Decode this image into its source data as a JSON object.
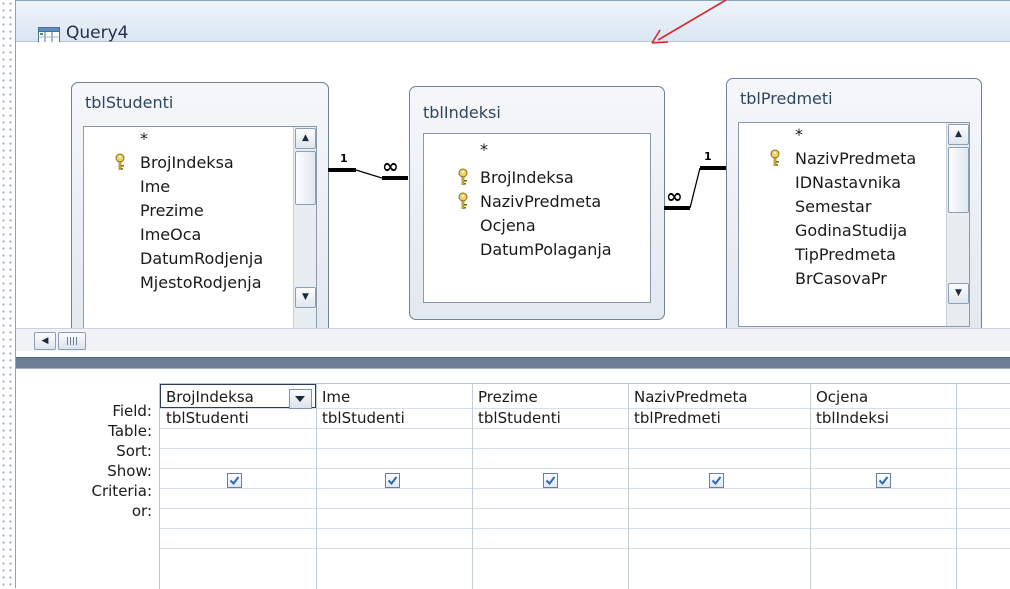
{
  "window": {
    "title": "Query4"
  },
  "tables": [
    {
      "name": "tblStudenti",
      "fields": [
        {
          "label": "*",
          "key": false
        },
        {
          "label": "BrojIndeksa",
          "key": true
        },
        {
          "label": "Ime",
          "key": false
        },
        {
          "label": "Prezime",
          "key": false
        },
        {
          "label": "ImeOca",
          "key": false
        },
        {
          "label": "DatumRodjenja",
          "key": false
        },
        {
          "label": "MjestoRodjenja",
          "key": false
        }
      ]
    },
    {
      "name": "tblIndeksi",
      "fields": [
        {
          "label": "*",
          "key": false
        },
        {
          "label": "BrojIndeksa",
          "key": true
        },
        {
          "label": "NazivPredmeta",
          "key": true
        },
        {
          "label": "Ocjena",
          "key": false
        },
        {
          "label": "DatumPolaganja",
          "key": false
        }
      ]
    },
    {
      "name": "tblPredmeti",
      "fields": [
        {
          "label": "*",
          "key": false
        },
        {
          "label": "NazivPredmeta",
          "key": true
        },
        {
          "label": "IDNastavnika",
          "key": false
        },
        {
          "label": "Semestar",
          "key": false
        },
        {
          "label": "GodinaStudija",
          "key": false
        },
        {
          "label": "TipPredmeta",
          "key": false
        },
        {
          "label": "BrCasovaPr",
          "key": false
        }
      ]
    }
  ],
  "joins": [
    {
      "one_label": "1",
      "many_label": "∞"
    },
    {
      "one_label": "1",
      "many_label": "∞"
    }
  ],
  "grid": {
    "row_labels": [
      "Field:",
      "Table:",
      "Sort:",
      "Show:",
      "Criteria:",
      "or:"
    ],
    "columns": [
      {
        "field": "BrojIndeksa",
        "table": "tblStudenti",
        "show": true
      },
      {
        "field": "Ime",
        "table": "tblStudenti",
        "show": true
      },
      {
        "field": "Prezime",
        "table": "tblStudenti",
        "show": true
      },
      {
        "field": "NazivPredmeta",
        "table": "tblPredmeti",
        "show": true
      },
      {
        "field": "Ocjena",
        "table": "tblIndeksi",
        "show": true
      }
    ]
  },
  "annotation": {
    "arrow_color": "#d42a2a"
  }
}
